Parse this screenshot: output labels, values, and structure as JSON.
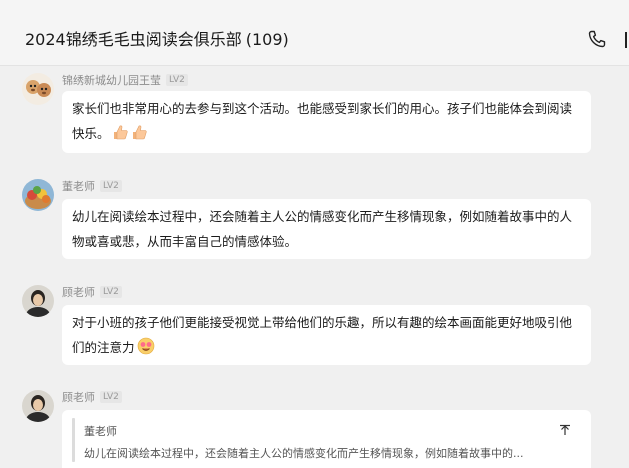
{
  "header": {
    "title": "2024锦绣毛毛虫阅读会俱乐部",
    "member_count": "(109)",
    "phone_icon": "phone-icon",
    "more_icon": "more-vertical-icon"
  },
  "messages": [
    {
      "sender": "锦绣新城幼儿园王莹",
      "level": "LV2",
      "text": "家长们也非常用心的去参与到这个活动。也能感受到家长们的用心。孩子们也能体会到阅读快乐。",
      "emoji": [
        "thumbs-up-emoji",
        "thumbs-up-emoji"
      ],
      "avatar": "cartoon-dogs-avatar"
    },
    {
      "sender": "董老师",
      "level": "LV2",
      "text": "幼儿在阅读绘本过程中，还会随着主人公的情感变化而产生移情现象，例如随着故事中的人物或喜或悲，从而丰富自己的情感体验。",
      "avatar": "fruit-bowl-avatar"
    },
    {
      "sender": "顾老师",
      "level": "LV2",
      "text": "对于小班的孩子他们更能接受视觉上带给他们的乐趣，所以有趣的绘本画面能更好地吸引他们的注意力",
      "emoji": [
        "star-eyes-emoji"
      ],
      "avatar": "portrait-avatar"
    },
    {
      "sender": "顾老师",
      "level": "LV2",
      "avatar": "portrait-avatar",
      "quote": {
        "name": "董老师",
        "text": "幼儿在阅读绘本过程中，还会随着主人公的情感变化而产生移情现象，例如随着故事中的...",
        "collapse_icon": "collapse-icon"
      }
    }
  ],
  "colors": {
    "background": "#f0f0f0",
    "bubble": "#ffffff",
    "meta_text": "#8c8c8c",
    "badge_bg": "#e6e6e6"
  }
}
